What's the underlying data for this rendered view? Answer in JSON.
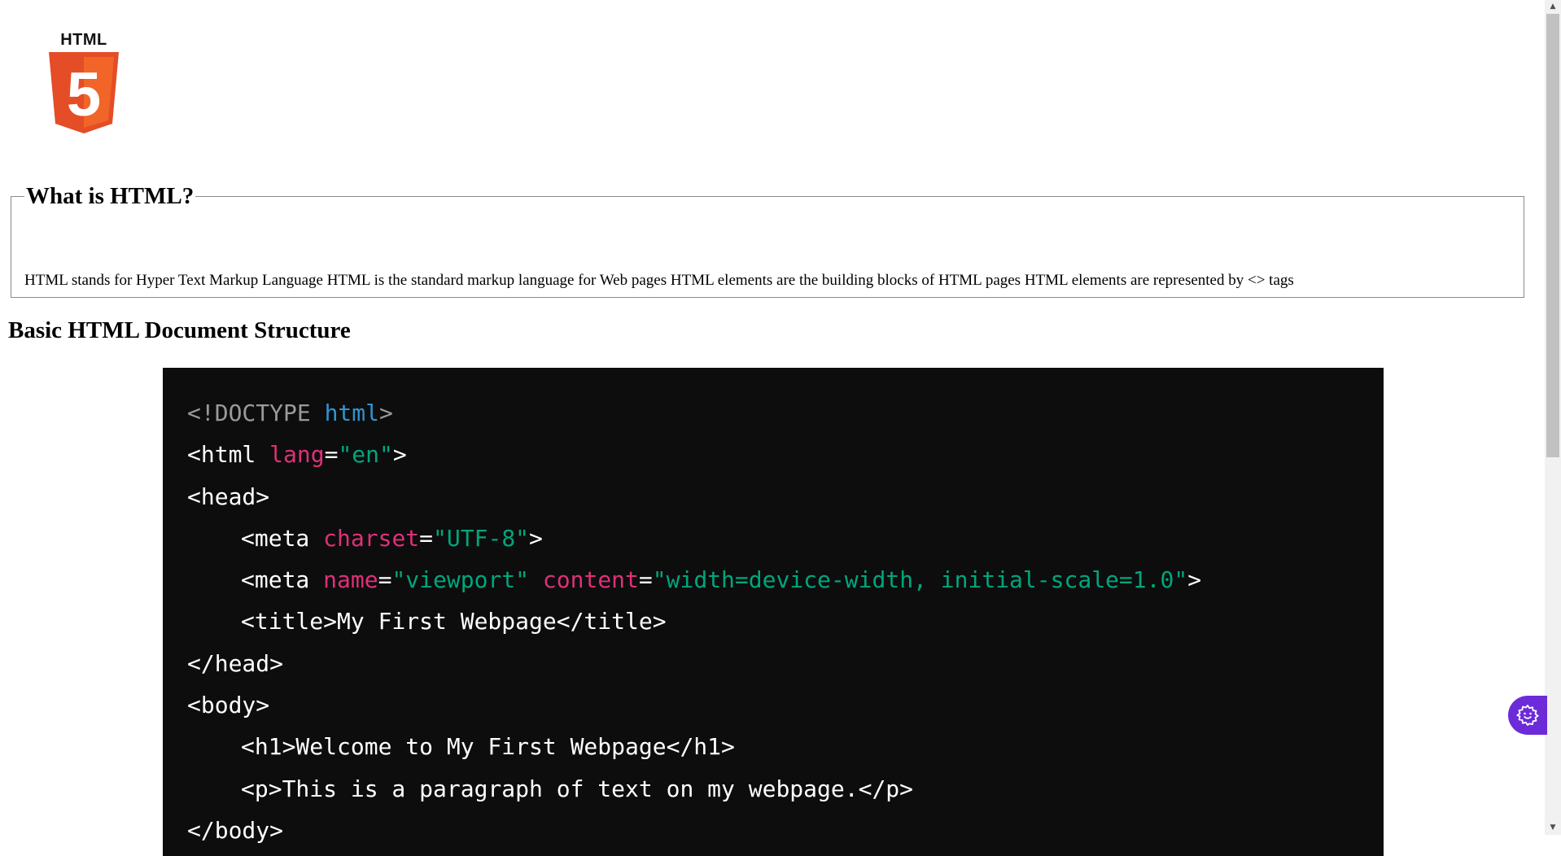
{
  "logo": {
    "word": "HTML",
    "numeral": "5",
    "colors": {
      "shield_dark": "#e44d26",
      "shield_light": "#f16529",
      "numeral": "#ffffff"
    }
  },
  "about": {
    "legend": "What is HTML?",
    "text": "HTML stands for Hyper Text Markup Language HTML is the standard markup language for Web pages HTML elements are the building blocks of HTML pages HTML elements are represented by <> tags"
  },
  "section_title": "Basic HTML Document Structure",
  "code": {
    "colors": {
      "background": "#0d0d0d",
      "doctype": "#9a9a9a",
      "keyword": "#2e95d3",
      "attribute": "#df3079",
      "string": "#00a67d",
      "text": "#ffffff"
    },
    "lines": [
      {
        "indent": false,
        "tokens": [
          {
            "t": "<!DOCTYPE ",
            "c": "doctype"
          },
          {
            "t": "html",
            "c": "kw"
          },
          {
            "t": ">",
            "c": "doctype"
          }
        ]
      },
      {
        "indent": false,
        "tokens": [
          {
            "t": "<html ",
            "c": "txt"
          },
          {
            "t": "lang",
            "c": "attr"
          },
          {
            "t": "=",
            "c": "txt"
          },
          {
            "t": "\"en\"",
            "c": "str"
          },
          {
            "t": ">",
            "c": "txt"
          }
        ]
      },
      {
        "indent": false,
        "tokens": [
          {
            "t": "<head>",
            "c": "txt"
          }
        ]
      },
      {
        "indent": true,
        "tokens": [
          {
            "t": "<meta ",
            "c": "txt"
          },
          {
            "t": "charset",
            "c": "attr"
          },
          {
            "t": "=",
            "c": "txt"
          },
          {
            "t": "\"UTF-8\"",
            "c": "str"
          },
          {
            "t": ">",
            "c": "txt"
          }
        ]
      },
      {
        "indent": true,
        "tokens": [
          {
            "t": "<meta ",
            "c": "txt"
          },
          {
            "t": "name",
            "c": "attr"
          },
          {
            "t": "=",
            "c": "txt"
          },
          {
            "t": "\"viewport\" ",
            "c": "str"
          },
          {
            "t": "content",
            "c": "attr"
          },
          {
            "t": "=",
            "c": "txt"
          },
          {
            "t": "\"width=device-width, initial-scale=1.0\"",
            "c": "str"
          },
          {
            "t": ">",
            "c": "txt"
          }
        ]
      },
      {
        "indent": true,
        "tokens": [
          {
            "t": "<title>My First Webpage</title>",
            "c": "txt"
          }
        ]
      },
      {
        "indent": false,
        "tokens": [
          {
            "t": "</head>",
            "c": "txt"
          }
        ]
      },
      {
        "indent": false,
        "tokens": [
          {
            "t": "<body>",
            "c": "txt"
          }
        ]
      },
      {
        "indent": true,
        "tokens": [
          {
            "t": "<h1>Welcome to My First Webpage</h1>",
            "c": "txt"
          }
        ]
      },
      {
        "indent": true,
        "tokens": [
          {
            "t": "<p>This is a paragraph of text on my webpage.</p>",
            "c": "txt"
          }
        ]
      },
      {
        "indent": false,
        "tokens": [
          {
            "t": "</body>",
            "c": "txt"
          }
        ]
      }
    ]
  },
  "scrollbar": {
    "up_icon": "triangle-up-icon",
    "down_icon": "triangle-down-icon"
  },
  "floating_widget": {
    "icon": "gear-smile-icon",
    "color": "#6c2bd9"
  }
}
